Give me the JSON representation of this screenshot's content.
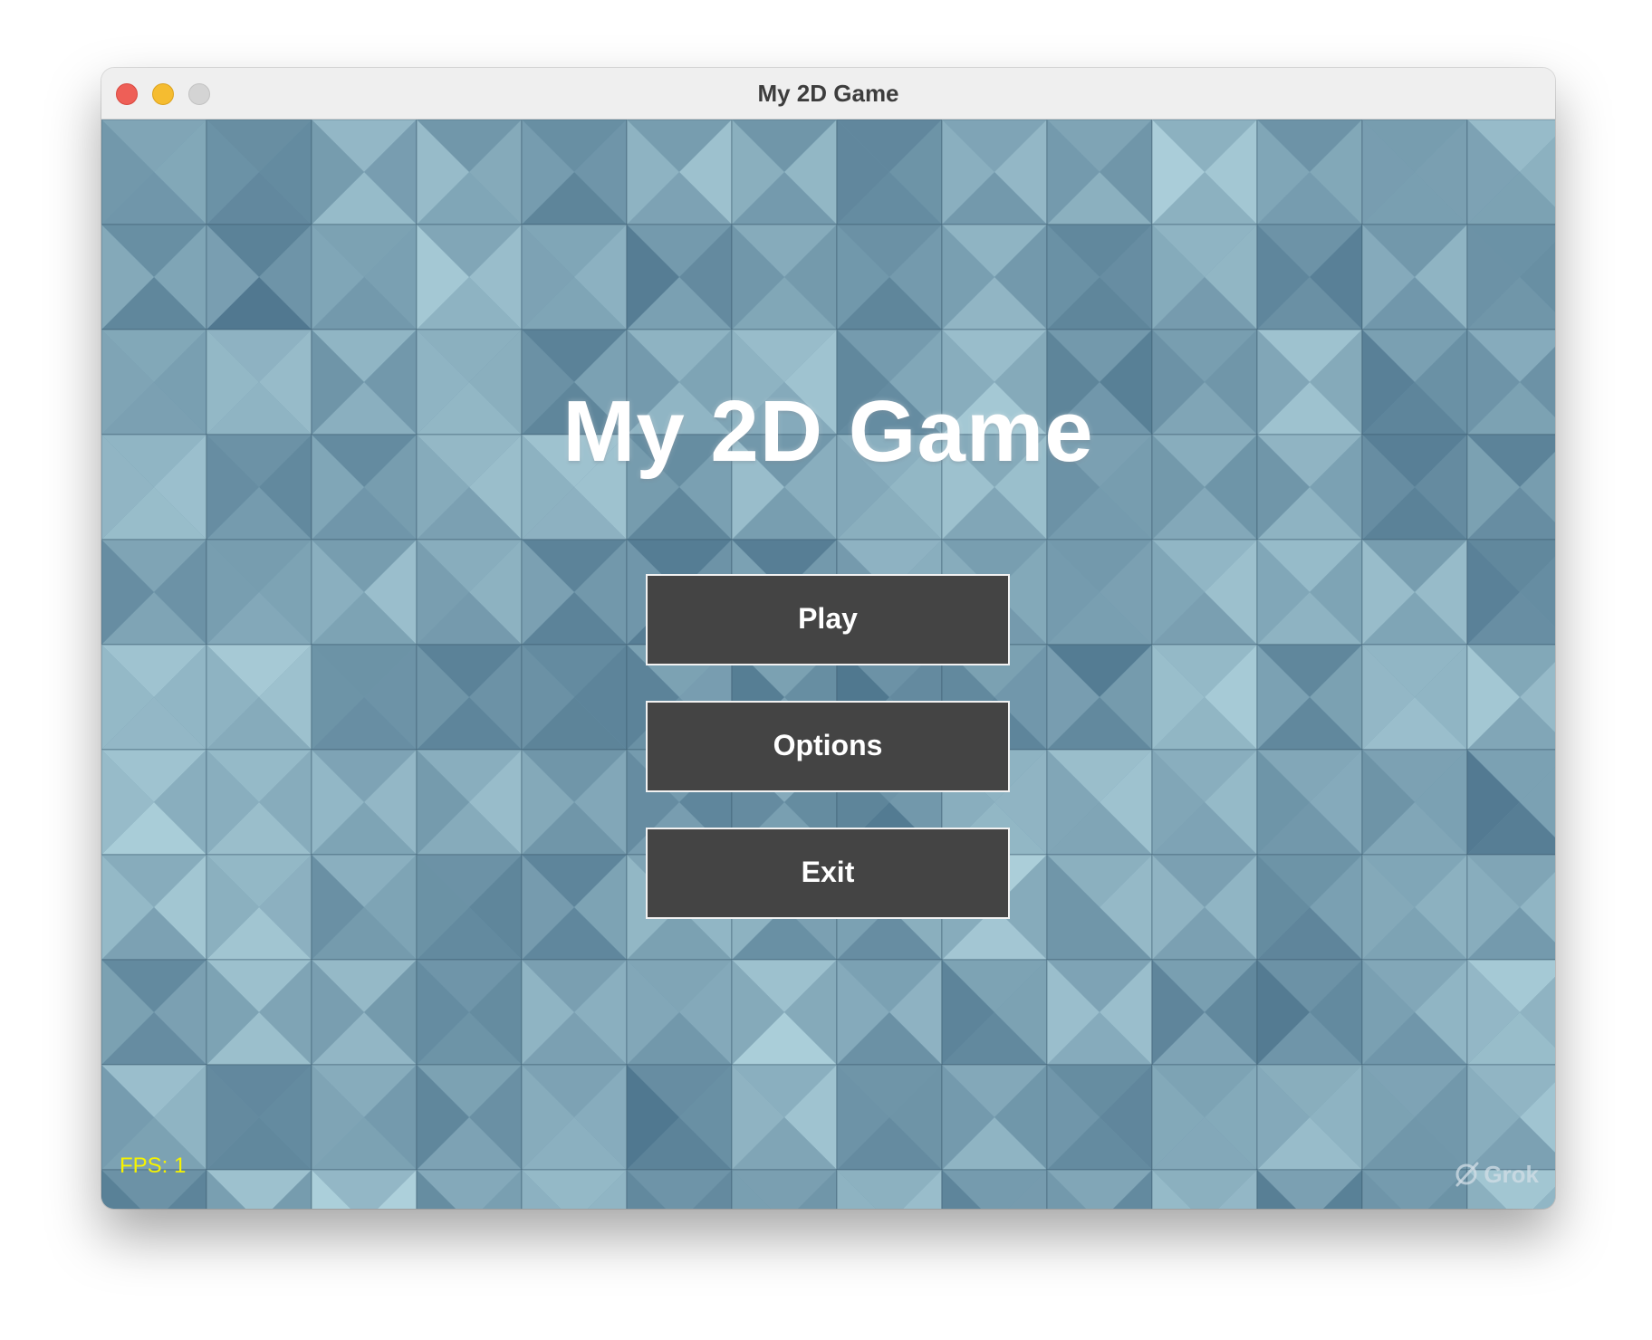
{
  "window": {
    "title": "My 2D Game"
  },
  "game": {
    "title": "My 2D Game",
    "buttons": {
      "play": "Play",
      "options": "Options",
      "exit": "Exit"
    },
    "fps_label": "FPS: 1",
    "watermark": "Grok"
  },
  "colors": {
    "button_bg": "#444444",
    "button_border": "#f2f2f2",
    "fps_text": "#f6f300",
    "background_base": "#6f97ad"
  }
}
